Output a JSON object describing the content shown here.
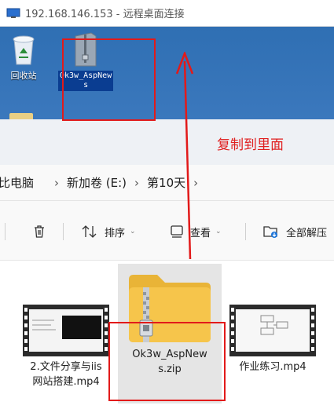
{
  "rdp": {
    "title": "192.168.146.153 - 远程桌面连接"
  },
  "desktop": {
    "icons": [
      {
        "label": "回收站",
        "icon": "recycle-bin-icon"
      },
      {
        "label_line1": "Ok3w_AspNew",
        "label_line2": "s",
        "icon": "zip-folder-icon"
      }
    ]
  },
  "annotation": {
    "text": "复制到里面",
    "color": "#e02020"
  },
  "breadcrumb": {
    "items": [
      "比电脑",
      "新加卷 (E:)",
      "第10天"
    ]
  },
  "toolbar": {
    "sort_label": "排序",
    "view_label": "查看",
    "extract_label": "全部解压"
  },
  "files": [
    {
      "name_line1": "2.文件分享与iis",
      "name_line2": "网站搭建.mp4",
      "icon": "video-file-icon"
    },
    {
      "name_line1": "Ok3w_AspNew",
      "name_line2": "s.zip",
      "icon": "zip-folder-icon"
    },
    {
      "name_line1": "作业练习.mp4",
      "icon": "video-file-icon"
    }
  ],
  "colors": {
    "accent_red": "#e21a1a",
    "desktop_blue": "#2f6fb3",
    "folder_yellow": "#f6c54b"
  }
}
